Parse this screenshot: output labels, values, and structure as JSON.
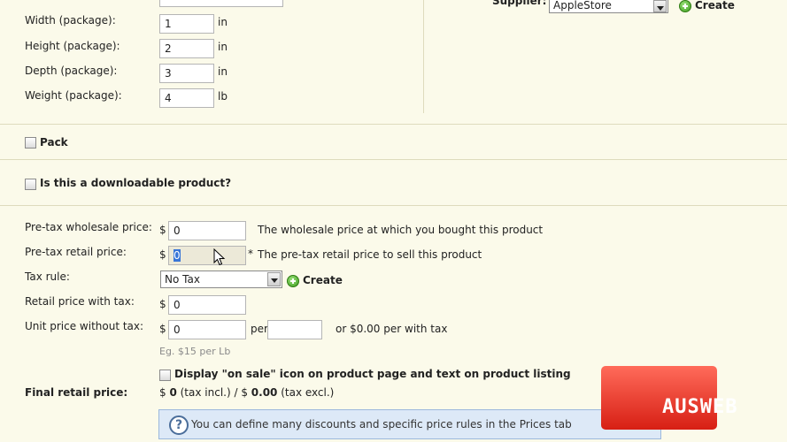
{
  "package": {
    "width": {
      "label": "Width (package):",
      "value": "1",
      "unit": "in"
    },
    "height": {
      "label": "Height (package):",
      "value": "2",
      "unit": "in"
    },
    "depth": {
      "label": "Depth (package):",
      "value": "3",
      "unit": "in"
    },
    "weight": {
      "label": "Weight (package):",
      "value": "4",
      "unit": "lb"
    }
  },
  "supplier": {
    "label": "Supplier:",
    "value": "AppleStore",
    "create_label": "Create"
  },
  "pack": {
    "label": "Pack"
  },
  "downloadable": {
    "label": "Is this a downloadable product?"
  },
  "pricing": {
    "currency": "$",
    "wholesale": {
      "label": "Pre-tax wholesale price:",
      "value": "0",
      "note": "The wholesale price at which you bought this product"
    },
    "retail": {
      "label": "Pre-tax retail price:",
      "value": "0",
      "required_mark": "*",
      "note": "The pre-tax retail price to sell this product"
    },
    "tax_rule": {
      "label": "Tax rule:",
      "value": "No Tax",
      "create_label": "Create"
    },
    "retail_with_tax": {
      "label": "Retail price with tax:",
      "value": "0"
    },
    "unit_price": {
      "label": "Unit price without tax:",
      "value": "0",
      "per_label": "per",
      "per_value": "",
      "note": "or $0.00 per with tax",
      "hint": "Eg. $15 per Lb"
    },
    "on_sale": {
      "label": "Display \"on sale\" icon on product page and text on product listing"
    },
    "final": {
      "label": "Final retail price:",
      "prefix": "$ ",
      "incl_value": "0",
      "incl_text": " (tax incl.) / $ ",
      "excl_value": "0.00",
      "excl_text": " (tax excl.)"
    }
  },
  "info": {
    "text": "You can define many discounts and specific price rules in the Prices tab"
  },
  "logo": {
    "text": "AUSWEB"
  }
}
